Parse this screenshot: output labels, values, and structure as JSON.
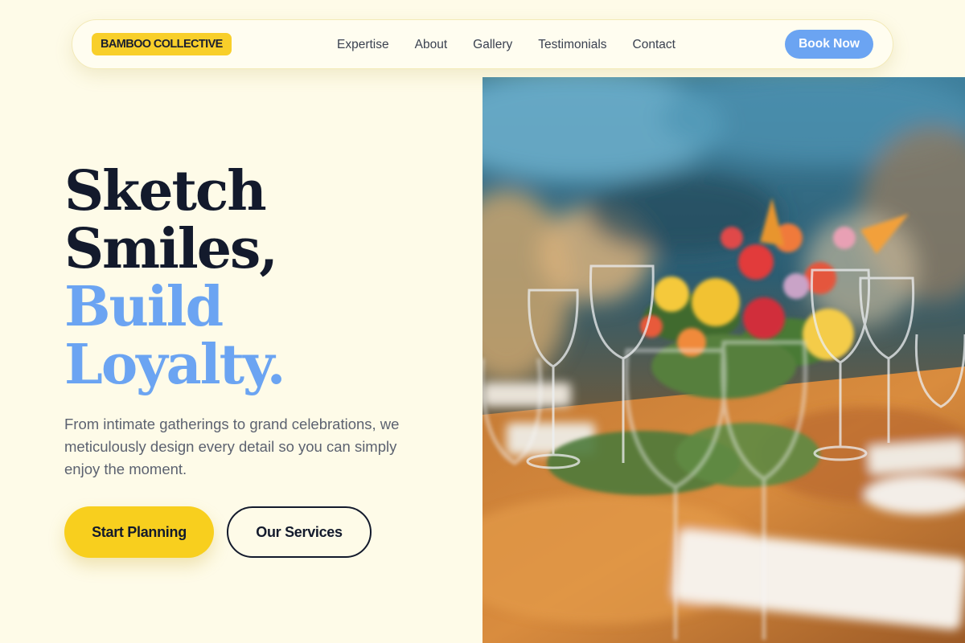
{
  "brand": {
    "logo_text": "BAMBOO COLLECTIVE"
  },
  "nav": {
    "links": [
      "Expertise",
      "About",
      "Gallery",
      "Testimonials",
      "Contact"
    ],
    "cta_label": "Book Now"
  },
  "hero": {
    "headline_dark_1": "Sketch",
    "headline_dark_2": "Smiles,",
    "headline_blue_1": "Build",
    "headline_blue_2": "Loyalty.",
    "subtext": "From intimate gatherings to grand celebrations, we meticulously design every detail so you can simply enjoy the moment.",
    "primary_cta": "Start Planning",
    "secondary_cta": "Our Services",
    "image_description": "event-table-floral-centerpiece-photo"
  },
  "colors": {
    "background": "#FEFBE8",
    "accent_yellow": "#F8CF1E",
    "accent_blue": "#6BA4F2",
    "text_dark": "#131A2C"
  }
}
